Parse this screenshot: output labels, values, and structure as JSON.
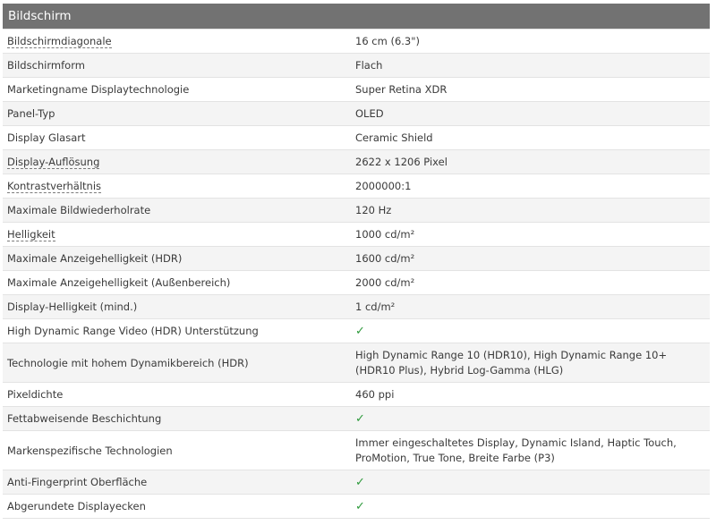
{
  "section_title": "Bildschirm",
  "rows": [
    {
      "label": "Bildschirmdiagonale",
      "value": "16 cm (6.3\")",
      "tooltip": true
    },
    {
      "label": "Bildschirmform",
      "value": "Flach"
    },
    {
      "label": "Marketingname Displaytechnologie",
      "value": "Super Retina XDR"
    },
    {
      "label": "Panel-Typ",
      "value": "OLED"
    },
    {
      "label": "Display Glasart",
      "value": "Ceramic Shield"
    },
    {
      "label": "Display-Auflösung",
      "value": "2622 x 1206 Pixel",
      "tooltip": true
    },
    {
      "label": "Kontrastverhältnis",
      "value": "2000000:1",
      "tooltip": true
    },
    {
      "label": "Maximale Bildwiederholrate",
      "value": "120 Hz"
    },
    {
      "label": "Helligkeit",
      "value": "1000 cd/m²",
      "tooltip": true
    },
    {
      "label": "Maximale Anzeigehelligkeit (HDR)",
      "value": "1600 cd/m²"
    },
    {
      "label": "Maximale Anzeigehelligkeit (Außenbereich)",
      "value": "2000 cd/m²"
    },
    {
      "label": "Display-Helligkeit (mind.)",
      "value": "1 cd/m²"
    },
    {
      "label": "High Dynamic Range Video (HDR) Unterstützung",
      "value": "✓",
      "check": true
    },
    {
      "label": "Technologie mit hohem Dynamikbereich (HDR)",
      "value": "High Dynamic Range 10 (HDR10), High Dynamic Range 10+ (HDR10 Plus), Hybrid Log-Gamma (HLG)",
      "tall": true
    },
    {
      "label": "Pixeldichte",
      "value": "460 ppi"
    },
    {
      "label": "Fettabweisende Beschichtung",
      "value": "✓",
      "check": true
    },
    {
      "label": "Markenspezifische Technologien",
      "value": "Immer eingeschaltetes Display, Dynamic Island, Haptic Touch, ProMotion, True Tone, Breite Farbe (P3)",
      "tall": true
    },
    {
      "label": "Anti-Fingerprint Oberfläche",
      "value": "✓",
      "check": true
    },
    {
      "label": "Abgerundete Displayecken",
      "value": "✓",
      "check": true
    }
  ],
  "colors": {
    "header_bg": "#727272",
    "check": "#2e9a3c",
    "row_alt": "#f4f4f4"
  }
}
